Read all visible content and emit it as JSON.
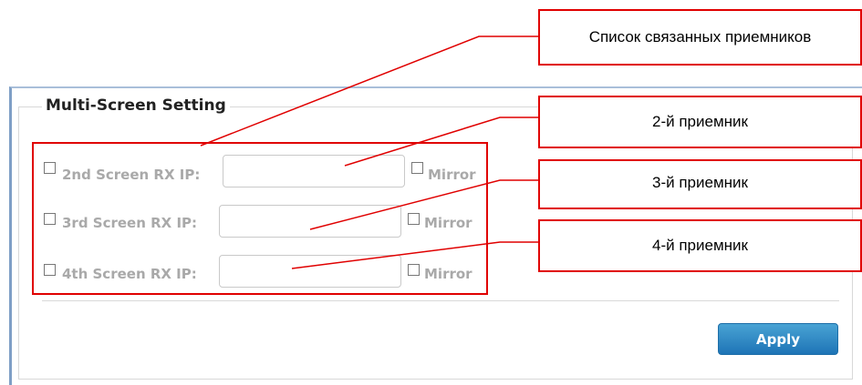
{
  "panel": {
    "title": "Multi-Screen Setting",
    "rows": [
      {
        "label": "2nd Screen RX IP:",
        "ip_value": "",
        "mirror_label": "Mirror"
      },
      {
        "label": "3rd Screen RX IP:",
        "ip_value": "",
        "mirror_label": "Mirror"
      },
      {
        "label": "4th Screen RX IP:",
        "ip_value": "",
        "mirror_label": "Mirror"
      }
    ],
    "apply_label": "Apply"
  },
  "annotations": {
    "linked_receivers": "Список связанных приемников",
    "receiver_2": "2-й приемник",
    "receiver_3": "3-й приемник",
    "receiver_4": "4-й приемник"
  },
  "colors": {
    "accent_blue": "#1e74b6",
    "annotation_red": "#e00000",
    "label_gray": "#a9a9a9"
  }
}
